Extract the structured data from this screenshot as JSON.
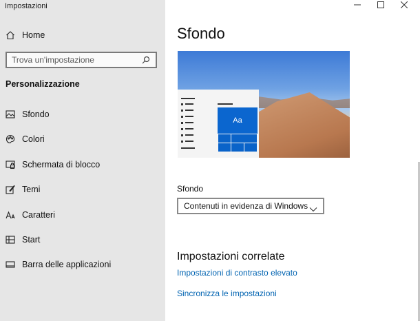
{
  "window": {
    "title": "Impostazioni",
    "controls": [
      "minimize-icon",
      "maximize-icon",
      "close-icon"
    ]
  },
  "sidebar": {
    "home": {
      "label": "Home",
      "icon": "home-icon"
    },
    "search": {
      "placeholder": "Trova un'impostazione",
      "icon": "search-icon"
    },
    "section_heading": "Personalizzazione",
    "items": [
      {
        "label": "Sfondo",
        "icon": "picture-icon"
      },
      {
        "label": "Colori",
        "icon": "palette-icon"
      },
      {
        "label": "Schermata di blocco",
        "icon": "lock-screen-icon"
      },
      {
        "label": "Temi",
        "icon": "theme-brush-icon"
      },
      {
        "label": "Caratteri",
        "icon": "font-icon"
      },
      {
        "label": "Start",
        "icon": "start-icon"
      },
      {
        "label": "Barra delle applicazioni",
        "icon": "taskbar-icon"
      }
    ]
  },
  "main": {
    "title": "Sfondo",
    "preview": {
      "tile_text": "Aa"
    },
    "background_label": "Sfondo",
    "background_value": "Contenuti in evidenza di Windows",
    "related": {
      "heading": "Impostazioni correlate",
      "links": [
        "Impostazioni di contrasto elevato",
        "Sincronizza le impostazioni"
      ]
    }
  },
  "colors": {
    "sidebar_bg": "#e6e6e6",
    "accent": "#0063b1",
    "tile_blue": "#0a63c9"
  }
}
